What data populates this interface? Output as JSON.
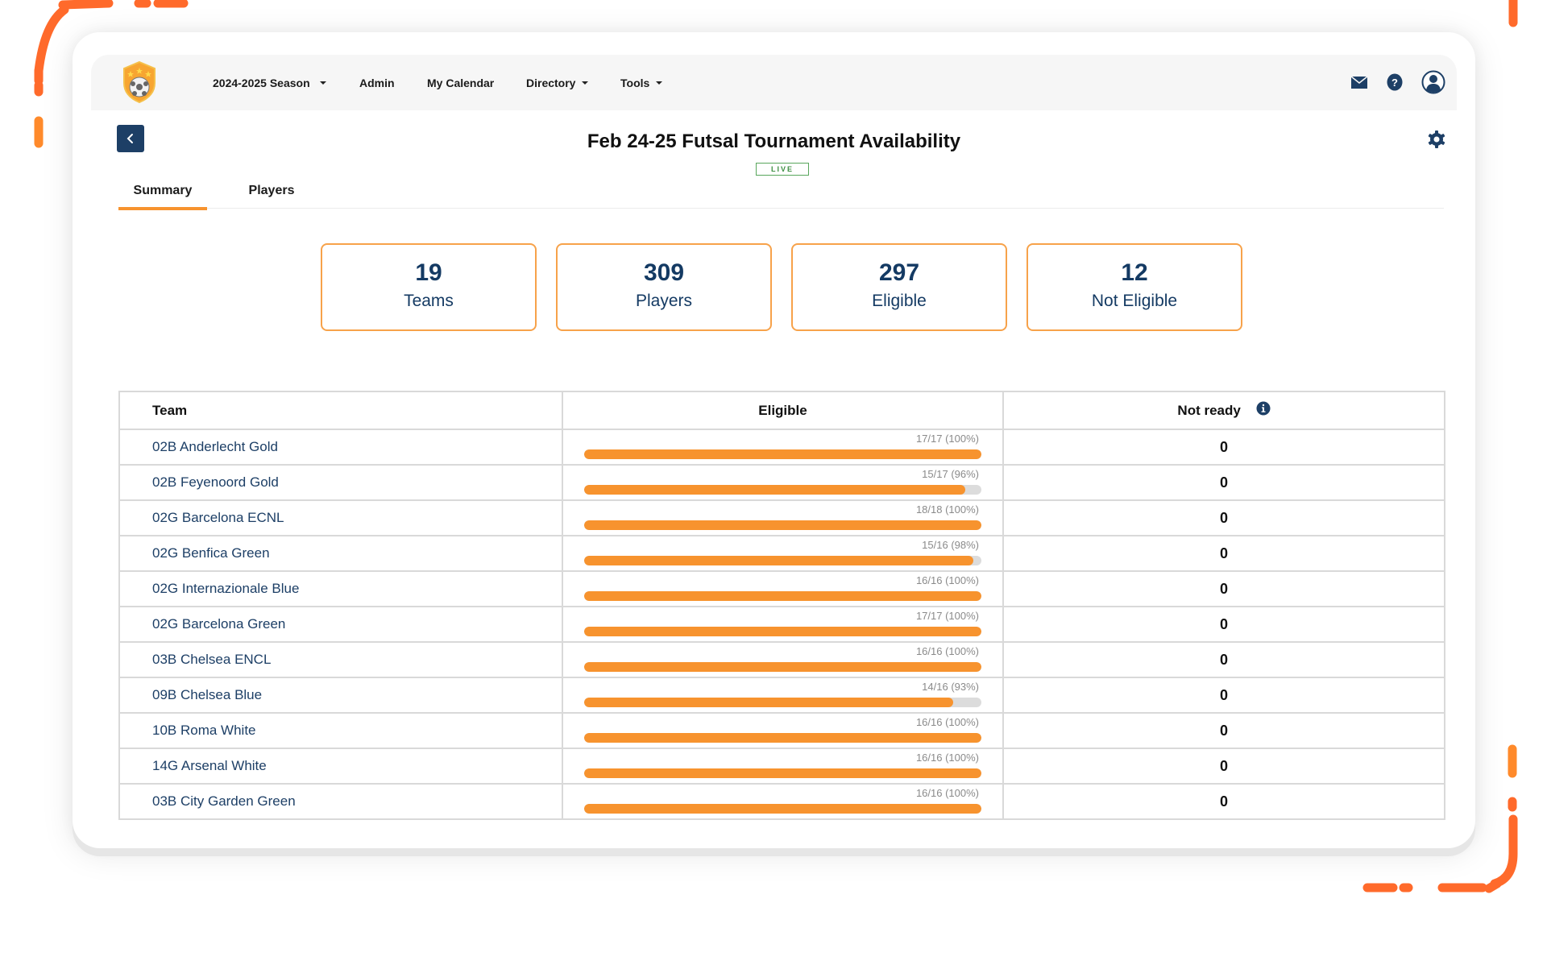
{
  "nav": {
    "items": [
      {
        "label": "2024-2025 Season",
        "dropdown": true
      },
      {
        "label": "Admin",
        "dropdown": false
      },
      {
        "label": "My Calendar",
        "dropdown": false
      },
      {
        "label": "Directory",
        "dropdown": true
      },
      {
        "label": "Tools",
        "dropdown": true
      }
    ],
    "icons": [
      "mail-icon",
      "help-icon",
      "user-account-icon"
    ]
  },
  "page": {
    "title": "Feb 24-25 Futsal Tournament Availability",
    "status_badge": "LIVE"
  },
  "tabs": [
    {
      "label": "Summary",
      "active": true
    },
    {
      "label": "Players",
      "active": false
    }
  ],
  "stats": [
    {
      "value": "19",
      "label": "Teams"
    },
    {
      "value": "309",
      "label": "Players"
    },
    {
      "value": "297",
      "label": "Eligible"
    },
    {
      "value": "12",
      "label": "Not Eligible"
    }
  ],
  "table": {
    "headers": {
      "team": "Team",
      "eligible": "Eligible",
      "not_ready": "Not ready"
    },
    "rows": [
      {
        "team": "02B Anderlecht Gold",
        "eligible_label": "17/17 (100%)",
        "eligible_pct": 100,
        "not_ready": "0"
      },
      {
        "team": "02B Feyenoord Gold",
        "eligible_label": "15/17 (96%)",
        "eligible_pct": 96,
        "not_ready": "0"
      },
      {
        "team": "02G Barcelona ECNL",
        "eligible_label": "18/18 (100%)",
        "eligible_pct": 100,
        "not_ready": "0"
      },
      {
        "team": "02G Benfica Green",
        "eligible_label": "15/16 (98%)",
        "eligible_pct": 98,
        "not_ready": "0"
      },
      {
        "team": "02G Internazionale Blue",
        "eligible_label": "16/16 (100%)",
        "eligible_pct": 100,
        "not_ready": "0"
      },
      {
        "team": "02G Barcelona Green",
        "eligible_label": "17/17 (100%)",
        "eligible_pct": 100,
        "not_ready": "0"
      },
      {
        "team": "03B Chelsea ENCL",
        "eligible_label": "16/16 (100%)",
        "eligible_pct": 100,
        "not_ready": "0"
      },
      {
        "team": "09B Chelsea Blue",
        "eligible_label": "14/16 (93%)",
        "eligible_pct": 93,
        "not_ready": "0"
      },
      {
        "team": "10B Roma White",
        "eligible_label": "16/16 (100%)",
        "eligible_pct": 100,
        "not_ready": "0"
      },
      {
        "team": "14G Arsenal White",
        "eligible_label": "16/16 (100%)",
        "eligible_pct": 100,
        "not_ready": "0"
      },
      {
        "team": "03B City Garden Green",
        "eligible_label": "16/16 (100%)",
        "eligible_pct": 100,
        "not_ready": "0"
      }
    ]
  },
  "colors": {
    "accent_orange": "#f7932e",
    "navy": "#1d3f66",
    "live_green": "#58a65c",
    "decor_orange": "#ff6a2b"
  }
}
